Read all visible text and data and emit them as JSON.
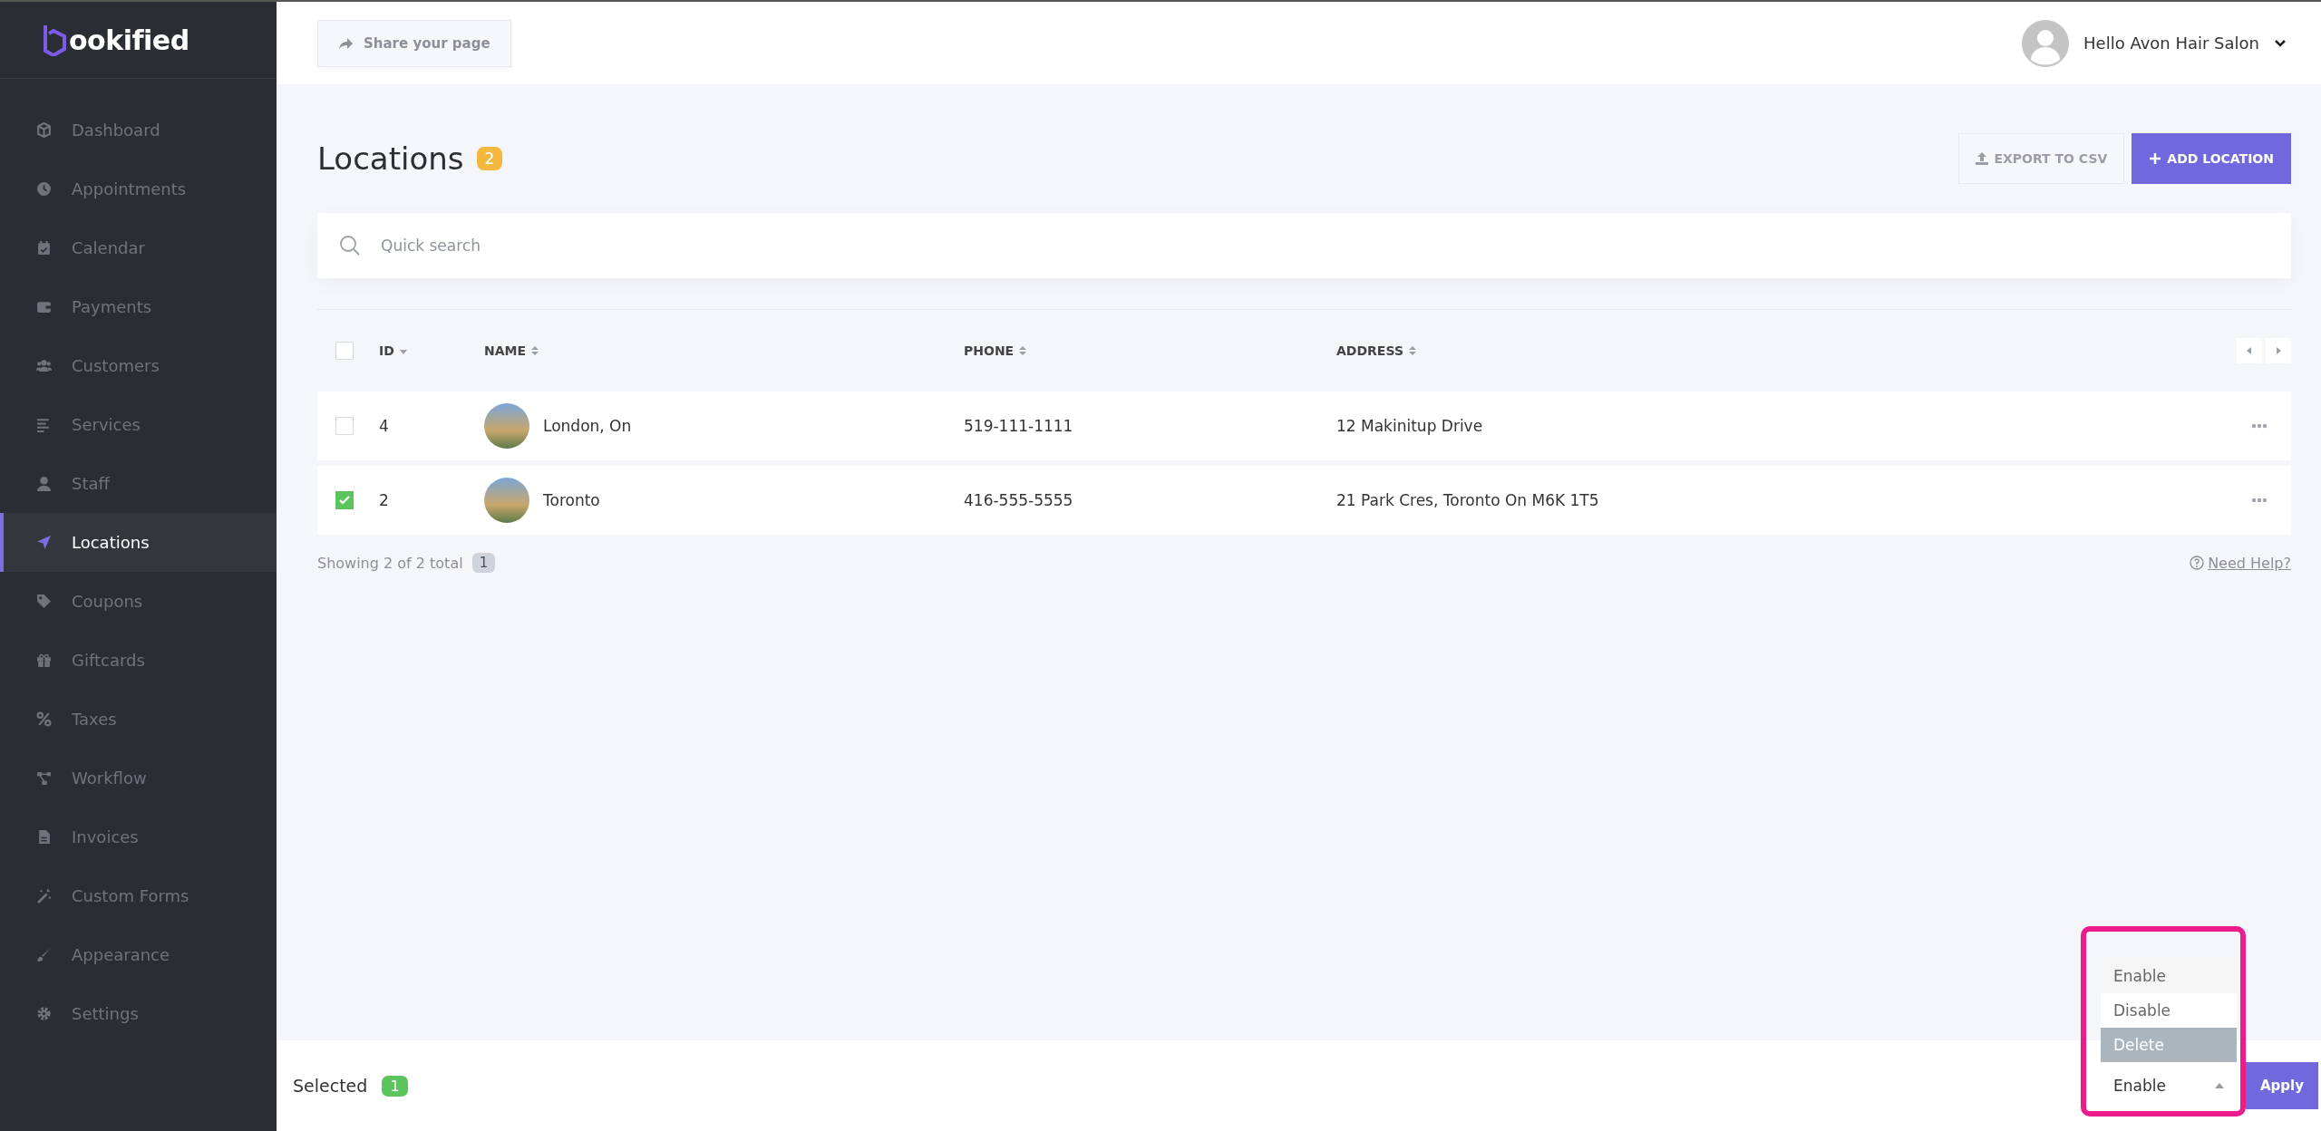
{
  "sidebar": {
    "logo": "ookified",
    "items": [
      {
        "label": "Dashboard",
        "selected": false
      },
      {
        "label": "Appointments",
        "selected": false
      },
      {
        "label": "Calendar",
        "selected": false
      },
      {
        "label": "Payments",
        "selected": false
      },
      {
        "label": "Customers",
        "selected": false
      },
      {
        "label": "Services",
        "selected": false
      },
      {
        "label": "Staff",
        "selected": false
      },
      {
        "label": "Locations",
        "selected": true
      },
      {
        "label": "Coupons",
        "selected": false
      },
      {
        "label": "Giftcards",
        "selected": false
      },
      {
        "label": "Taxes",
        "selected": false
      },
      {
        "label": "Workflow",
        "selected": false
      },
      {
        "label": "Invoices",
        "selected": false
      },
      {
        "label": "Custom Forms",
        "selected": false
      },
      {
        "label": "Appearance",
        "selected": false
      },
      {
        "label": "Settings",
        "selected": false
      }
    ]
  },
  "header": {
    "share_button": "Share your page",
    "user": "Hello Avon Hair Salon"
  },
  "page": {
    "title": "Locations",
    "count": "2",
    "export_button": "EXPORT TO CSV",
    "add_button": "ADD LOCATION"
  },
  "search": {
    "placeholder": "Quick search"
  },
  "table": {
    "header_checked": false,
    "columns": [
      {
        "label": "ID",
        "sorted": true
      },
      {
        "label": "NAME",
        "sorted": false
      },
      {
        "label": "PHONE",
        "sorted": false
      },
      {
        "label": "ADDRESS",
        "sorted": false
      }
    ],
    "rows": [
      {
        "checked": false,
        "id": "4",
        "name": "London, On",
        "phone": "519-111-1111",
        "address": "12 Makinitup Drive"
      },
      {
        "checked": true,
        "id": "2",
        "name": "Toronto",
        "phone": "416-555-5555",
        "address": "21 Park Cres, Toronto On M6K 1T5"
      }
    ]
  },
  "footer": {
    "showing": "Showing 2 of 2 total",
    "page": "1",
    "help": "Need Help?"
  },
  "bulk_bar": {
    "selected_label": "Selected",
    "selected_count": "1",
    "value": "Enable",
    "expanded": true,
    "apply": "Apply",
    "options": [
      {
        "label": "Enable",
        "selected": true,
        "highlighted": false
      },
      {
        "label": "Disable",
        "selected": false,
        "highlighted": false
      },
      {
        "label": "Delete",
        "selected": false,
        "highlighted": true
      }
    ]
  }
}
